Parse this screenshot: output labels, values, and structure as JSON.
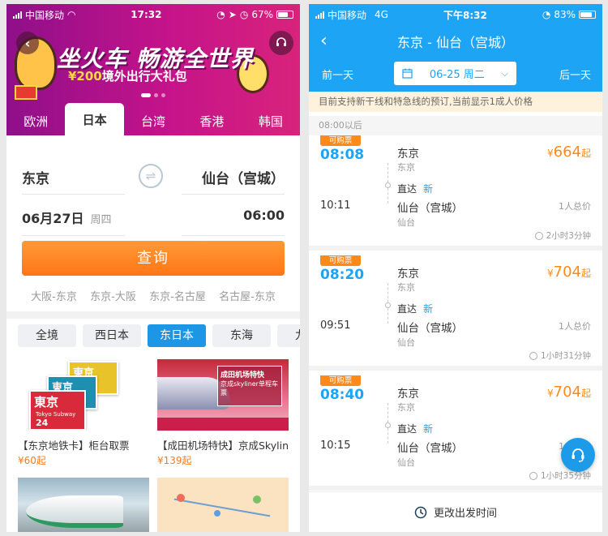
{
  "left": {
    "status": {
      "carrier": "中国移动",
      "time": "17:32",
      "battery": "67%"
    },
    "banner": {
      "title": "坐火车 畅游全世界",
      "subtitle_amount": "¥200",
      "subtitle_text": "境外出行大礼包"
    },
    "tabs": [
      {
        "label": "欧洲"
      },
      {
        "label": "日本"
      },
      {
        "label": "台湾"
      },
      {
        "label": "香港"
      },
      {
        "label": "韩国"
      }
    ],
    "form": {
      "from": "东京",
      "to": "仙台（宫城）",
      "date": "06月27日",
      "weekday": "周四",
      "time": "06:00",
      "query_label": "查询"
    },
    "history": [
      "大阪-东京",
      "东京-大阪",
      "东京-名古屋",
      "名古屋-东京"
    ],
    "regions": [
      "全境",
      "西日本",
      "东日本",
      "东海",
      "九州"
    ],
    "products": [
      {
        "title": "【东京地铁卡】柜台取票",
        "price": "¥60起"
      },
      {
        "title": "【成田机场特快】京成Skyliner",
        "price": "¥139起"
      }
    ],
    "ticket_text": {
      "big": "東京",
      "sub": "Tokyo Subway",
      "hr": "24"
    },
    "skyliner_text": {
      "line1": "成田机场特快",
      "line2": "京成skyliner单程车票"
    }
  },
  "right": {
    "status": {
      "carrier": "中国移动",
      "network": "4G",
      "time": "下午8:32",
      "battery": "83%"
    },
    "title": "东京 - 仙台（宫城）",
    "prev_day": "前一天",
    "next_day": "后一天",
    "date": "06-25 周二",
    "notice": "目前支持新干线和特急线的预订,当前显示1成人价格",
    "section": "08:00以后",
    "trains": [
      {
        "tag": "可购票",
        "dep": "08:08",
        "arr": "10:11",
        "from": "东京",
        "from_sub": "东京",
        "type": "直达",
        "badge": "新",
        "to": "仙台（宫城）",
        "to_sub": "仙台",
        "currency": "¥",
        "price": "664",
        "price_suffix": "起",
        "note": "1人总价",
        "duration": "2小时3分钟"
      },
      {
        "tag": "可购票",
        "dep": "08:20",
        "arr": "09:51",
        "from": "东京",
        "from_sub": "东京",
        "type": "直达",
        "badge": "新",
        "to": "仙台（宫城）",
        "to_sub": "仙台",
        "currency": "¥",
        "price": "704",
        "price_suffix": "起",
        "note": "1人总价",
        "duration": "1小时31分钟"
      },
      {
        "tag": "可购票",
        "dep": "08:40",
        "arr": "10:15",
        "from": "东京",
        "from_sub": "东京",
        "type": "直达",
        "badge": "新",
        "to": "仙台（宫城）",
        "to_sub": "仙台",
        "currency": "¥",
        "price": "704",
        "price_suffix": "起",
        "note": "1人总价",
        "duration": "1小时35分钟"
      }
    ],
    "footer": "更改出发时间"
  },
  "colors": {
    "accent_blue": "#1da4f5",
    "orange": "#ff8a1a",
    "banner_magenta": "#c5138a"
  }
}
